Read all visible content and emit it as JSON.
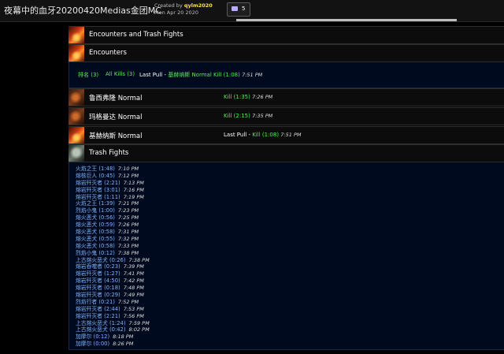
{
  "report": {
    "title": "夜幕中的血牙20200420Medias金团MC",
    "created_by_label": "Created by",
    "author": "qylm2020",
    "date": "Mon Apr 20 2020",
    "comment_count": "5"
  },
  "sections": {
    "encounters_trash": {
      "label": "Encounters and Trash Fights"
    },
    "encounters": {
      "label": "Encounters"
    },
    "trash": {
      "label": "Trash Fights"
    }
  },
  "summary": {
    "ranking": "排名 (3)",
    "all_kills": "All Kills (3)",
    "last_pull_label": "Last Pull - ",
    "last_pull_value": "基赫纳斯 Normal Kill (1:08)",
    "last_pull_time": "7:51 PM"
  },
  "fights": [
    {
      "name": "鲁西弗隆 Normal",
      "prefix": "",
      "result": "Kill (1:35)",
      "time": "7:26 PM"
    },
    {
      "name": "玛格曼达 Normal",
      "prefix": "",
      "result": "Kill (2:15)",
      "time": "7:35 PM"
    },
    {
      "name": "基赫纳斯 Normal",
      "prefix": "Last Pull - ",
      "result": "Kill (1:08)",
      "time": "7:51 PM"
    }
  ],
  "trash": [
    {
      "name": "火焰之王 (1:48)",
      "time": "7:10 PM"
    },
    {
      "name": "熔核巨人 (0:45)",
      "time": "7:12 PM"
    },
    {
      "name": "熔岩歼灭者 (2:21)",
      "time": "7:13 PM"
    },
    {
      "name": "熔岩歼灭者 (3:01)",
      "time": "7:16 PM"
    },
    {
      "name": "熔岩歼灭者 (1:11)",
      "time": "7:19 PM"
    },
    {
      "name": "火焰之王 (1:39)",
      "time": "7:21 PM"
    },
    {
      "name": "烈焰小鬼 (1:00)",
      "time": "7:23 PM"
    },
    {
      "name": "熔火恶犬 (0:56)",
      "time": "7:25 PM"
    },
    {
      "name": "熔火恶犬 (0:59)",
      "time": "7:26 PM"
    },
    {
      "name": "熔火恶犬 (0:58)",
      "time": "7:31 PM"
    },
    {
      "name": "熔火恶犬 (0:55)",
      "time": "7:32 PM"
    },
    {
      "name": "熔火恶犬 (0:58)",
      "time": "7:33 PM"
    },
    {
      "name": "烈焰小鬼 (0:12)",
      "time": "7:38 PM"
    },
    {
      "name": "上古熔火恶犬 (0:26)",
      "time": "7:38 PM"
    },
    {
      "name": "熔岩吞噬者 (0:23)",
      "time": "7:39 PM"
    },
    {
      "name": "熔岩歼灭者 (1:27)",
      "time": "7:41 PM"
    },
    {
      "name": "熔岩歼灭者 (4:50)",
      "time": "7:42 PM"
    },
    {
      "name": "熔岩歼灭者 (0:18)",
      "time": "7:48 PM"
    },
    {
      "name": "熔岩歼灭者 (0:29)",
      "time": "7:49 PM"
    },
    {
      "name": "烈焰行者 (0:21)",
      "time": "7:52 PM"
    },
    {
      "name": "熔岩歼灭者 (2:44)",
      "time": "7:53 PM"
    },
    {
      "name": "熔岩歼灭者 (2:21)",
      "time": "7:56 PM"
    },
    {
      "name": "上古熔火恶犬 (1:24)",
      "time": "7:59 PM"
    },
    {
      "name": "上古熔火恶犬 (0:42)",
      "time": "8:02 PM"
    },
    {
      "name": "加摩尔 (0:12)",
      "time": "8:18 PM"
    },
    {
      "name": "加摩尔 (0:00)",
      "time": "8:26 PM"
    }
  ]
}
